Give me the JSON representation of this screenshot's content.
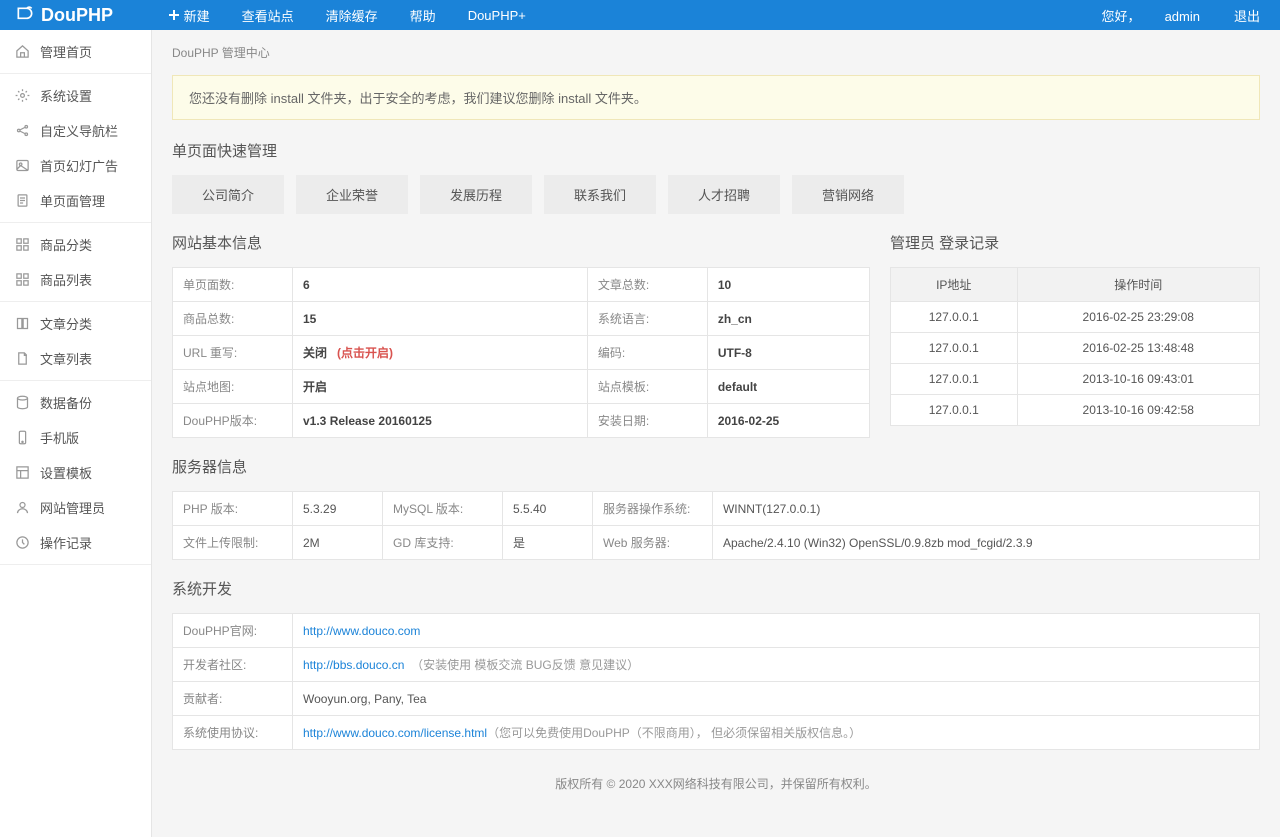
{
  "brand": "DouPHP",
  "topnav": {
    "new": "新建",
    "view": "查看站点",
    "clear": "清除缓存",
    "help": "帮助",
    "plus": "DouPHP+"
  },
  "user": {
    "greeting": "您好，",
    "name": "admin",
    "logout": "退出"
  },
  "sidebar": [
    {
      "label": "管理首页",
      "icon": "home"
    },
    {
      "label": "系统设置",
      "icon": "gear"
    },
    {
      "label": "自定义导航栏",
      "icon": "share"
    },
    {
      "label": "首页幻灯广告",
      "icon": "image"
    },
    {
      "label": "单页面管理",
      "icon": "doc"
    },
    {
      "label": "商品分类",
      "icon": "grid"
    },
    {
      "label": "商品列表",
      "icon": "grid"
    },
    {
      "label": "文章分类",
      "icon": "book"
    },
    {
      "label": "文章列表",
      "icon": "page"
    },
    {
      "label": "数据备份",
      "icon": "db"
    },
    {
      "label": "手机版",
      "icon": "phone"
    },
    {
      "label": "设置模板",
      "icon": "tpl"
    },
    {
      "label": "网站管理员",
      "icon": "user"
    },
    {
      "label": "操作记录",
      "icon": "clock"
    }
  ],
  "breadcrumb": "DouPHP 管理中心",
  "alert": "您还没有删除 install 文件夹，出于安全的考虑，我们建议您删除 install 文件夹。",
  "sections": {
    "quick": "单页面快速管理",
    "siteinfo": "网站基本信息",
    "loginlog": "管理员 登录记录",
    "server": "服务器信息",
    "dev": "系统开发"
  },
  "tabs": [
    "公司简介",
    "企业荣誉",
    "发展历程",
    "联系我们",
    "人才招聘",
    "营销网络"
  ],
  "siteinfo": {
    "pages_l": "单页面数:",
    "pages_v": "6",
    "arts_l": "文章总数:",
    "arts_v": "10",
    "goods_l": "商品总数:",
    "goods_v": "15",
    "lang_l": "系统语言:",
    "lang_v": "zh_cn",
    "rewrite_l": "URL 重写:",
    "rewrite_v": "关闭",
    "rewrite_action": "(点击开启)",
    "encode_l": "编码:",
    "encode_v": "UTF-8",
    "sitemap_l": "站点地图:",
    "sitemap_v": "开启",
    "tpl_l": "站点模板:",
    "tpl_v": "default",
    "ver_l": "DouPHP版本:",
    "ver_v": "v1.3 Release 20160125",
    "install_l": "安装日期:",
    "install_v": "2016-02-25"
  },
  "loglabels": {
    "ip": "IP地址",
    "time": "操作时间"
  },
  "loginlog": [
    {
      "ip": "127.0.0.1",
      "time": "2016-02-25 23:29:08"
    },
    {
      "ip": "127.0.0.1",
      "time": "2016-02-25 13:48:48"
    },
    {
      "ip": "127.0.0.1",
      "time": "2013-10-16 09:43:01"
    },
    {
      "ip": "127.0.0.1",
      "time": "2013-10-16 09:42:58"
    }
  ],
  "server": {
    "php_l": "PHP 版本:",
    "php_v": "5.3.29",
    "mysql_l": "MySQL 版本:",
    "mysql_v": "5.5.40",
    "os_l": "服务器操作系统:",
    "os_v": "WINNT(127.0.0.1)",
    "upload_l": "文件上传限制:",
    "upload_v": "2M",
    "gd_l": "GD 库支持:",
    "gd_v": "是",
    "web_l": "Web 服务器:",
    "web_v": "Apache/2.4.10 (Win32) OpenSSL/0.9.8zb mod_fcgid/2.3.9"
  },
  "dev": {
    "off_l": "DouPHP官网:",
    "off_v": "http://www.douco.com",
    "bbs_l": "开发者社区:",
    "bbs_v": "http://bbs.douco.cn",
    "bbs_note": "（安装使用 模板交流 BUG反馈 意见建议）",
    "contrib_l": "贡献者:",
    "contrib_v": "Wooyun.org, Pany, Tea",
    "lic_l": "系统使用协议:",
    "lic_v": "http://www.douco.com/license.html",
    "lic_note": "（您可以免费使用DouPHP（不限商用）， 但必须保留相关版权信息。）"
  },
  "footer": "版权所有 © 2020 XXX网络科技有限公司，并保留所有权利。"
}
